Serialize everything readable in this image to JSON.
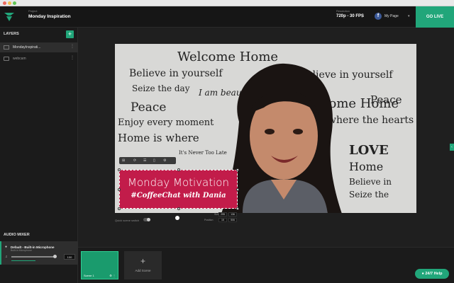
{
  "topbar": {
    "project_label": "Project",
    "project_name": "Monday Inspiration",
    "resolution_label": "Resolution",
    "resolution_value": "720p - 30 FPS",
    "page_name": "My Page",
    "go_live_label": "GO LIVE"
  },
  "layers": {
    "title": "LAYERS",
    "items": [
      {
        "label": "MondayInspirati..."
      },
      {
        "label": "webcam"
      }
    ]
  },
  "audio_mixer": {
    "title": "AUDIO MIXER",
    "device_name": "Default - Built-in Microphone",
    "device_sub": "Built-in Microphone",
    "volume": "100",
    "volume_fraction": 0.95
  },
  "canvas": {
    "lower_third_title": "Monday Motivation",
    "lower_third_subtitle": "#CoffeeChat with Dania",
    "wall_words": [
      "Welcome Home",
      "Believe in yourself",
      "Seize the day",
      "I am beautiful.",
      "Peace",
      "Enjoy every moment",
      "where the hearts is",
      "LOVE",
      "Dreams",
      "Enjoy Life",
      "Live Your Dream",
      "Believe in",
      "Seize the",
      "Home",
      "Peace",
      "It's Never Too Late",
      "Home is where"
    ]
  },
  "controls": {
    "quick_switch_label": "Quick scene switch",
    "size_label": "Size",
    "size_w": "295",
    "size_h": "136",
    "position_label": "Position",
    "pos_x": "15",
    "pos_y": "506"
  },
  "scenes": {
    "items": [
      {
        "name": "Scene 1"
      }
    ],
    "add_label": "Add Scene"
  },
  "help_label": "24/7 Help",
  "colors": {
    "accent": "#21a67a",
    "lower_third": "#c21c4a",
    "facebook": "#3b5998"
  }
}
